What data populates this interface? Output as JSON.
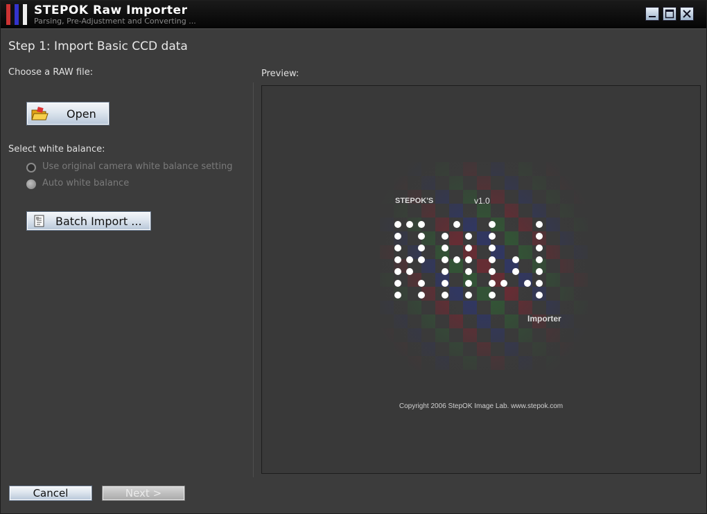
{
  "window": {
    "title": "STEPOK Raw Importer",
    "subtitle": "Parsing, Pre-Adjustment and Converting ...",
    "icon": "checkerboard-app-icon",
    "controls": [
      "minimize-icon",
      "maximize-icon",
      "close-icon"
    ]
  },
  "step": {
    "title": "Step 1: Import Basic CCD data"
  },
  "left": {
    "choose_label": "Choose a RAW file:",
    "open_button": "Open",
    "open_icon": "folder-open-icon",
    "wb_label": "Select white balance:",
    "wb_options": [
      {
        "label": "Use original camera white balance setting",
        "selected": false,
        "enabled": false
      },
      {
        "label": "Auto white balance",
        "selected": true,
        "enabled": false
      }
    ],
    "batch_button": "Batch Import ...",
    "batch_icon": "batch-document-icon"
  },
  "preview": {
    "label": "Preview:",
    "splash": {
      "brand": "STEPOK'S",
      "version": "v1.0",
      "product": "RAW",
      "subproduct": "Importer",
      "copyright": "Copyright 2006 StepOK Image Lab. www.stepok.com"
    }
  },
  "footer": {
    "cancel_button": "Cancel",
    "next_button": "Next >",
    "next_enabled": false
  },
  "colors": {
    "background": "#3c3c3c",
    "titlebar": "#0a0a0a",
    "checker_red": "#8a2430",
    "checker_green": "#2f6a34",
    "checker_blue": "#2b3780"
  }
}
